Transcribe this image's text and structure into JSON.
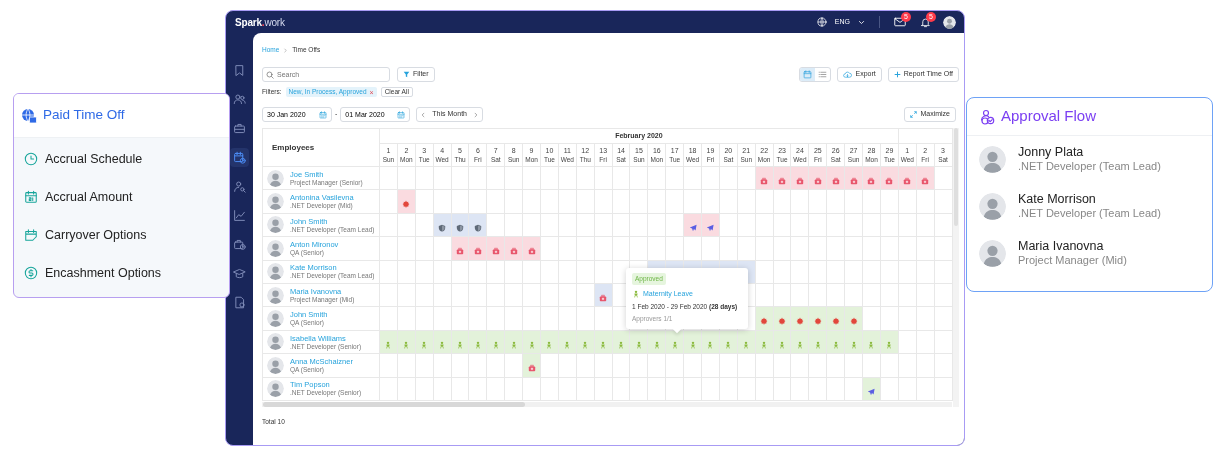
{
  "topbar": {
    "logo": {
      "name": "Spark",
      "dot": ".",
      "suffix": "work"
    },
    "language": "ENG",
    "mail_badge": "5",
    "bell_badge": "5"
  },
  "sidebar": {
    "items": [
      {
        "kind": "bookmark",
        "selected": false
      },
      {
        "kind": "team",
        "selected": false
      },
      {
        "kind": "briefcase",
        "selected": false
      },
      {
        "kind": "calendar",
        "selected": true
      },
      {
        "kind": "user-search",
        "selected": false
      },
      {
        "kind": "chart",
        "selected": false
      },
      {
        "kind": "bag-clock",
        "selected": false
      },
      {
        "kind": "education",
        "selected": false
      },
      {
        "kind": "report",
        "selected": false
      }
    ]
  },
  "breadcrumb": [
    "Home",
    "Time Offs"
  ],
  "toolbar": {
    "search": {
      "placeholder": "Search"
    },
    "filter": "Filter",
    "views": [
      {
        "kind": "calendar",
        "selected": true
      },
      {
        "kind": "list",
        "selected": false
      }
    ],
    "export": "Export",
    "report": "Report Time Off"
  },
  "filters": {
    "label": "Filters:",
    "chips": [
      {
        "text": "New, In Process, Approved",
        "remove": "×"
      }
    ],
    "clear": "Clear All"
  },
  "period": {
    "from": "30 Jan 2020",
    "separator": "-",
    "to": "01 Mar 2020",
    "label": "This Month",
    "maximize": "Maximize"
  },
  "calendar": {
    "employees_heading": "Employees",
    "months": [
      {
        "label": "February 2020",
        "days": [
          {
            "day": "1",
            "weekday": "Sun"
          },
          {
            "day": "2",
            "weekday": "Mon"
          },
          {
            "day": "3",
            "weekday": "Tue"
          },
          {
            "day": "4",
            "weekday": "Wed"
          },
          {
            "day": "5",
            "weekday": "Thu"
          },
          {
            "day": "6",
            "weekday": "Fri"
          },
          {
            "day": "7",
            "weekday": "Sat"
          },
          {
            "day": "8",
            "weekday": "Sun"
          },
          {
            "day": "9",
            "weekday": "Mon"
          },
          {
            "day": "10",
            "weekday": "Tue"
          },
          {
            "day": "11",
            "weekday": "Wed"
          },
          {
            "day": "12",
            "weekday": "Thu"
          },
          {
            "day": "13",
            "weekday": "Fri"
          },
          {
            "day": "14",
            "weekday": "Sat"
          },
          {
            "day": "15",
            "weekday": "Sun"
          },
          {
            "day": "16",
            "weekday": "Mon"
          },
          {
            "day": "17",
            "weekday": "Tue"
          },
          {
            "day": "18",
            "weekday": "Wed"
          },
          {
            "day": "19",
            "weekday": "Fri"
          },
          {
            "day": "20",
            "weekday": "Sat"
          },
          {
            "day": "21",
            "weekday": "Sun"
          },
          {
            "day": "22",
            "weekday": "Mon"
          },
          {
            "day": "23",
            "weekday": "Tue"
          },
          {
            "day": "24",
            "weekday": "Wed"
          },
          {
            "day": "25",
            "weekday": "Fri"
          },
          {
            "day": "26",
            "weekday": "Sat"
          },
          {
            "day": "27",
            "weekday": "Sun"
          },
          {
            "day": "28",
            "weekday": "Mon"
          },
          {
            "day": "29",
            "weekday": "Tue"
          }
        ]
      },
      {
        "days": [
          {
            "day": "1",
            "weekday": "Wed"
          },
          {
            "day": "2",
            "weekday": "Fri"
          },
          {
            "day": "3",
            "weekday": "Sat"
          }
        ]
      }
    ],
    "employees": [
      {
        "name": "Joe Smith",
        "role": "Project Manager (Senior)",
        "cells": [
          {
            "kind": "empty"
          },
          {
            "kind": "empty"
          },
          {
            "kind": "empty"
          },
          {
            "kind": "empty"
          },
          {
            "kind": "empty"
          },
          {
            "kind": "empty"
          },
          {
            "kind": "empty"
          },
          {
            "kind": "empty"
          },
          {
            "kind": "empty"
          },
          {
            "kind": "empty"
          },
          {
            "kind": "empty"
          },
          {
            "kind": "empty"
          },
          {
            "kind": "empty"
          },
          {
            "kind": "empty"
          },
          {
            "kind": "empty"
          },
          {
            "kind": "empty"
          },
          {
            "kind": "empty"
          },
          {
            "kind": "empty"
          },
          {
            "kind": "empty"
          },
          {
            "kind": "empty"
          },
          {
            "kind": "empty"
          },
          {
            "kind": "sick",
            "color": "#fadbe0"
          },
          {
            "kind": "sick",
            "color": "#fadbe0"
          },
          {
            "kind": "sick",
            "color": "#fadbe0"
          },
          {
            "kind": "sick",
            "color": "#fadbe0"
          },
          {
            "kind": "sick",
            "color": "#fadbe0"
          },
          {
            "kind": "sick",
            "color": "#fadbe0"
          },
          {
            "kind": "sick",
            "color": "#fadbe0"
          },
          {
            "kind": "sick",
            "color": "#fadbe0"
          },
          {
            "kind": "sick",
            "color": "#fadbe0"
          },
          {
            "kind": "sick",
            "color": "#fadbe0"
          },
          {
            "kind": "empty"
          }
        ]
      },
      {
        "name": "Antonina Vasilevna",
        "role": ".NET Developer (Mid)",
        "cells": [
          {
            "kind": "empty"
          },
          {
            "kind": "virus",
            "color": "#fadbe0"
          },
          {
            "kind": "empty"
          },
          {
            "kind": "empty"
          },
          {
            "kind": "empty"
          },
          {
            "kind": "empty"
          },
          {
            "kind": "empty"
          },
          {
            "kind": "empty"
          },
          {
            "kind": "empty"
          },
          {
            "kind": "empty"
          },
          {
            "kind": "empty"
          },
          {
            "kind": "empty"
          },
          {
            "kind": "empty"
          },
          {
            "kind": "empty"
          },
          {
            "kind": "empty"
          },
          {
            "kind": "empty"
          },
          {
            "kind": "empty"
          },
          {
            "kind": "empty"
          },
          {
            "kind": "empty"
          },
          {
            "kind": "empty"
          },
          {
            "kind": "empty"
          },
          {
            "kind": "empty"
          },
          {
            "kind": "empty"
          },
          {
            "kind": "empty"
          },
          {
            "kind": "empty"
          },
          {
            "kind": "empty"
          },
          {
            "kind": "empty"
          },
          {
            "kind": "empty"
          },
          {
            "kind": "empty"
          },
          {
            "kind": "empty"
          },
          {
            "kind": "empty"
          },
          {
            "kind": "empty"
          }
        ]
      },
      {
        "name": "John Smith",
        "role": ".NET Developer (Team Lead)",
        "cells": [
          {
            "kind": "empty"
          },
          {
            "kind": "empty"
          },
          {
            "kind": "empty"
          },
          {
            "kind": "shield",
            "color": "#dde5f4"
          },
          {
            "kind": "shield",
            "color": "#dde5f4"
          },
          {
            "kind": "shield",
            "color": "#dde5f4"
          },
          {
            "kind": "empty"
          },
          {
            "kind": "empty"
          },
          {
            "kind": "empty"
          },
          {
            "kind": "empty"
          },
          {
            "kind": "empty"
          },
          {
            "kind": "empty"
          },
          {
            "kind": "empty"
          },
          {
            "kind": "empty"
          },
          {
            "kind": "empty"
          },
          {
            "kind": "empty"
          },
          {
            "kind": "empty"
          },
          {
            "kind": "plane",
            "color": "#fadbe0"
          },
          {
            "kind": "plane",
            "color": "#fadbe0"
          },
          {
            "kind": "empty"
          },
          {
            "kind": "empty"
          },
          {
            "kind": "empty"
          },
          {
            "kind": "empty"
          },
          {
            "kind": "empty"
          },
          {
            "kind": "empty"
          },
          {
            "kind": "empty"
          },
          {
            "kind": "empty"
          },
          {
            "kind": "empty"
          },
          {
            "kind": "empty"
          },
          {
            "kind": "empty"
          },
          {
            "kind": "empty"
          },
          {
            "kind": "empty"
          }
        ]
      },
      {
        "name": "Anton Mironov",
        "role": "QA (Senior)",
        "cells": [
          {
            "kind": "empty"
          },
          {
            "kind": "empty"
          },
          {
            "kind": "empty"
          },
          {
            "kind": "empty"
          },
          {
            "kind": "sick",
            "color": "#fadbe0"
          },
          {
            "kind": "sick",
            "color": "#fadbe0"
          },
          {
            "kind": "sick",
            "color": "#fadbe0"
          },
          {
            "kind": "sick",
            "color": "#fadbe0"
          },
          {
            "kind": "sick",
            "color": "#fadbe0"
          },
          {
            "kind": "empty"
          },
          {
            "kind": "empty"
          },
          {
            "kind": "empty"
          },
          {
            "kind": "empty"
          },
          {
            "kind": "empty"
          },
          {
            "kind": "empty"
          },
          {
            "kind": "empty"
          },
          {
            "kind": "empty"
          },
          {
            "kind": "empty"
          },
          {
            "kind": "empty"
          },
          {
            "kind": "empty"
          },
          {
            "kind": "empty"
          },
          {
            "kind": "empty"
          },
          {
            "kind": "empty"
          },
          {
            "kind": "empty"
          },
          {
            "kind": "empty"
          },
          {
            "kind": "empty"
          },
          {
            "kind": "empty"
          },
          {
            "kind": "empty"
          },
          {
            "kind": "empty"
          },
          {
            "kind": "empty"
          },
          {
            "kind": "empty"
          },
          {
            "kind": "empty"
          }
        ]
      },
      {
        "name": "Kate Morrison",
        "role": ".NET Developer (Team Lead)",
        "cells": [
          {
            "kind": "empty"
          },
          {
            "kind": "empty"
          },
          {
            "kind": "empty"
          },
          {
            "kind": "empty"
          },
          {
            "kind": "empty"
          },
          {
            "kind": "empty"
          },
          {
            "kind": "empty"
          },
          {
            "kind": "empty"
          },
          {
            "kind": "empty"
          },
          {
            "kind": "empty"
          },
          {
            "kind": "empty"
          },
          {
            "kind": "empty"
          },
          {
            "kind": "empty"
          },
          {
            "kind": "empty"
          },
          {
            "kind": "empty"
          },
          {
            "kind": "empty",
            "color": "#dde5f4"
          },
          {
            "kind": "empty",
            "color": "#dde5f4"
          },
          {
            "kind": "empty",
            "color": "#dde5f4"
          },
          {
            "kind": "empty",
            "color": "#dde5f4"
          },
          {
            "kind": "empty",
            "color": "#dde5f4"
          },
          {
            "kind": "empty",
            "color": "#dde5f4"
          },
          {
            "kind": "empty"
          },
          {
            "kind": "empty"
          },
          {
            "kind": "empty"
          },
          {
            "kind": "empty"
          },
          {
            "kind": "empty"
          },
          {
            "kind": "empty"
          },
          {
            "kind": "empty"
          },
          {
            "kind": "empty"
          },
          {
            "kind": "empty"
          },
          {
            "kind": "empty"
          },
          {
            "kind": "empty"
          }
        ]
      },
      {
        "name": "Maria Ivanovna",
        "role": "Project Manager (Mid)",
        "cells": [
          {
            "kind": "empty"
          },
          {
            "kind": "empty"
          },
          {
            "kind": "empty"
          },
          {
            "kind": "empty"
          },
          {
            "kind": "empty"
          },
          {
            "kind": "empty"
          },
          {
            "kind": "empty"
          },
          {
            "kind": "empty"
          },
          {
            "kind": "empty"
          },
          {
            "kind": "empty"
          },
          {
            "kind": "empty"
          },
          {
            "kind": "empty"
          },
          {
            "kind": "sick",
            "color": "#dde5f4"
          },
          {
            "kind": "empty"
          },
          {
            "kind": "empty"
          },
          {
            "kind": "empty"
          },
          {
            "kind": "empty"
          },
          {
            "kind": "empty"
          },
          {
            "kind": "empty"
          },
          {
            "kind": "empty"
          },
          {
            "kind": "empty"
          },
          {
            "kind": "empty"
          },
          {
            "kind": "empty"
          },
          {
            "kind": "empty"
          },
          {
            "kind": "empty"
          },
          {
            "kind": "empty"
          },
          {
            "kind": "empty"
          },
          {
            "kind": "empty"
          },
          {
            "kind": "empty"
          },
          {
            "kind": "empty"
          },
          {
            "kind": "empty"
          },
          {
            "kind": "empty"
          }
        ]
      },
      {
        "name": "John Smith",
        "role": "QA (Senior)",
        "cells": [
          {
            "kind": "empty"
          },
          {
            "kind": "empty"
          },
          {
            "kind": "empty"
          },
          {
            "kind": "empty"
          },
          {
            "kind": "empty"
          },
          {
            "kind": "empty"
          },
          {
            "kind": "empty"
          },
          {
            "kind": "empty"
          },
          {
            "kind": "empty"
          },
          {
            "kind": "empty"
          },
          {
            "kind": "empty"
          },
          {
            "kind": "empty"
          },
          {
            "kind": "empty"
          },
          {
            "kind": "empty"
          },
          {
            "kind": "empty"
          },
          {
            "kind": "empty"
          },
          {
            "kind": "empty"
          },
          {
            "kind": "empty"
          },
          {
            "kind": "empty"
          },
          {
            "kind": "empty"
          },
          {
            "kind": "empty"
          },
          {
            "kind": "virus",
            "color": "#e3f2da"
          },
          {
            "kind": "virus",
            "color": "#e3f2da"
          },
          {
            "kind": "virus",
            "color": "#e3f2da"
          },
          {
            "kind": "virus",
            "color": "#e3f2da"
          },
          {
            "kind": "virus",
            "color": "#e3f2da"
          },
          {
            "kind": "virus",
            "color": "#e3f2da"
          },
          {
            "kind": "empty"
          },
          {
            "kind": "empty"
          },
          {
            "kind": "empty"
          },
          {
            "kind": "empty"
          },
          {
            "kind": "empty"
          }
        ]
      },
      {
        "name": "Isabella Williams",
        "role": ".NET Developer (Senior)",
        "cells": [
          {
            "kind": "baby",
            "color": "#e3f2da"
          },
          {
            "kind": "baby",
            "color": "#e3f2da"
          },
          {
            "kind": "baby",
            "color": "#e3f2da"
          },
          {
            "kind": "baby",
            "color": "#e3f2da"
          },
          {
            "kind": "baby",
            "color": "#e3f2da"
          },
          {
            "kind": "baby",
            "color": "#e3f2da"
          },
          {
            "kind": "baby",
            "color": "#e3f2da"
          },
          {
            "kind": "baby",
            "color": "#e3f2da"
          },
          {
            "kind": "baby",
            "color": "#e3f2da"
          },
          {
            "kind": "baby",
            "color": "#e3f2da"
          },
          {
            "kind": "baby",
            "color": "#e3f2da"
          },
          {
            "kind": "baby",
            "color": "#e3f2da"
          },
          {
            "kind": "baby",
            "color": "#e3f2da"
          },
          {
            "kind": "baby",
            "color": "#e3f2da"
          },
          {
            "kind": "baby",
            "color": "#e3f2da"
          },
          {
            "kind": "baby",
            "color": "#e3f2da"
          },
          {
            "kind": "baby",
            "color": "#e3f2da"
          },
          {
            "kind": "baby",
            "color": "#e3f2da"
          },
          {
            "kind": "baby",
            "color": "#e3f2da"
          },
          {
            "kind": "baby",
            "color": "#e3f2da"
          },
          {
            "kind": "baby",
            "color": "#e3f2da"
          },
          {
            "kind": "baby",
            "color": "#e3f2da"
          },
          {
            "kind": "baby",
            "color": "#e3f2da"
          },
          {
            "kind": "baby",
            "color": "#e3f2da"
          },
          {
            "kind": "baby",
            "color": "#e3f2da"
          },
          {
            "kind": "baby",
            "color": "#e3f2da"
          },
          {
            "kind": "baby",
            "color": "#e3f2da"
          },
          {
            "kind": "baby",
            "color": "#e3f2da"
          },
          {
            "kind": "baby",
            "color": "#e3f2da"
          },
          {
            "kind": "empty"
          },
          {
            "kind": "empty"
          },
          {
            "kind": "empty"
          }
        ]
      },
      {
        "name": "Anna McSchaizner",
        "role": "QA (Senior)",
        "cells": [
          {
            "kind": "empty"
          },
          {
            "kind": "empty"
          },
          {
            "kind": "empty"
          },
          {
            "kind": "empty"
          },
          {
            "kind": "empty"
          },
          {
            "kind": "empty"
          },
          {
            "kind": "empty"
          },
          {
            "kind": "empty"
          },
          {
            "kind": "sick",
            "color": "#e3f2da"
          },
          {
            "kind": "empty"
          },
          {
            "kind": "empty"
          },
          {
            "kind": "empty"
          },
          {
            "kind": "empty"
          },
          {
            "kind": "empty"
          },
          {
            "kind": "empty"
          },
          {
            "kind": "empty"
          },
          {
            "kind": "empty"
          },
          {
            "kind": "empty"
          },
          {
            "kind": "empty"
          },
          {
            "kind": "empty"
          },
          {
            "kind": "empty"
          },
          {
            "kind": "empty"
          },
          {
            "kind": "empty"
          },
          {
            "kind": "empty"
          },
          {
            "kind": "empty"
          },
          {
            "kind": "empty"
          },
          {
            "kind": "empty"
          },
          {
            "kind": "empty"
          },
          {
            "kind": "empty"
          },
          {
            "kind": "empty"
          },
          {
            "kind": "empty"
          },
          {
            "kind": "empty"
          }
        ]
      },
      {
        "name": "Tim Popson",
        "role": ".NET Developer (Senior)",
        "cells": [
          {
            "kind": "empty"
          },
          {
            "kind": "empty"
          },
          {
            "kind": "empty"
          },
          {
            "kind": "empty"
          },
          {
            "kind": "empty"
          },
          {
            "kind": "empty"
          },
          {
            "kind": "empty"
          },
          {
            "kind": "empty"
          },
          {
            "kind": "empty"
          },
          {
            "kind": "empty"
          },
          {
            "kind": "empty"
          },
          {
            "kind": "empty"
          },
          {
            "kind": "empty"
          },
          {
            "kind": "empty"
          },
          {
            "kind": "empty"
          },
          {
            "kind": "empty"
          },
          {
            "kind": "empty"
          },
          {
            "kind": "empty"
          },
          {
            "kind": "empty"
          },
          {
            "kind": "empty"
          },
          {
            "kind": "empty"
          },
          {
            "kind": "empty"
          },
          {
            "kind": "empty"
          },
          {
            "kind": "empty"
          },
          {
            "kind": "empty"
          },
          {
            "kind": "empty"
          },
          {
            "kind": "empty"
          },
          {
            "kind": "plane",
            "color": "#e3f2da"
          },
          {
            "kind": "empty"
          },
          {
            "kind": "empty"
          },
          {
            "kind": "empty"
          },
          {
            "kind": "empty"
          }
        ]
      }
    ],
    "tooltip": {
      "status": "Approved",
      "title": "Maternity Leave",
      "dates": "1 Feb 2020 - 29 Feb 2020 **(28 days)**",
      "approvers": "Approvers 1/1"
    }
  },
  "total": "Total 10",
  "pto_card": {
    "title": "Paid Time Off",
    "items": [
      {
        "kind": "clock",
        "label": "Accrual Schedule"
      },
      {
        "kind": "calendar-number",
        "label": "Accrual Amount"
      },
      {
        "kind": "calendar-edit",
        "label": "Carryover Options"
      },
      {
        "kind": "dollar",
        "label": "Encashment Options"
      }
    ]
  },
  "approval_card": {
    "title": "Approval Flow",
    "people": [
      {
        "name": "Jonny Plata",
        "role": ".NET Developer (Team Lead)"
      },
      {
        "name": "Kate Morrison",
        "role": ".NET Developer (Team Lead)"
      },
      {
        "name": "Maria Ivanovna",
        "role": "Project Manager (Mid)"
      }
    ]
  }
}
